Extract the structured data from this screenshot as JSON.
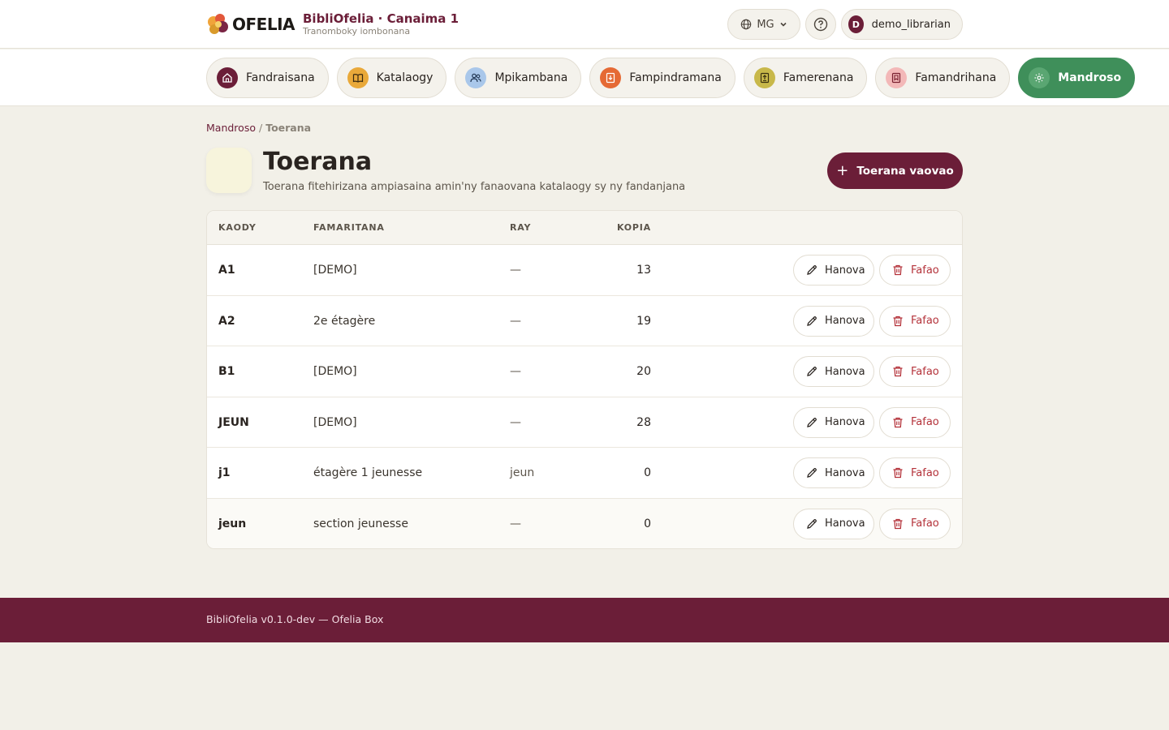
{
  "header": {
    "logo_text": "OFELIA",
    "app_title": "BibliOfelia · Canaima 1",
    "app_subtitle": "Tranomboky iombonana",
    "language": "MG",
    "user_initial": "D",
    "username": "demo_librarian"
  },
  "nav": {
    "items": [
      {
        "label": "Fandraisana",
        "icon": "home-icon",
        "color": "#6b1e38"
      },
      {
        "label": "Katalaogy",
        "icon": "book-icon",
        "color": "#e9a93a"
      },
      {
        "label": "Mpikambana",
        "icon": "users-icon",
        "color": "#a9c7ea"
      },
      {
        "label": "Fampindramana",
        "icon": "loan-icon",
        "color": "#e56a35"
      },
      {
        "label": "Famerenana",
        "icon": "return-icon",
        "color": "#c8b84a"
      },
      {
        "label": "Famandrihana",
        "icon": "reserve-icon",
        "color": "#f3b8b8"
      },
      {
        "label": "Mandroso",
        "icon": "gear-icon",
        "color": "#3f8f5a"
      }
    ],
    "active_index": 6
  },
  "breadcrumb": {
    "parent": "Mandroso",
    "separator": "/",
    "current": "Toerana"
  },
  "page": {
    "title": "Toerana",
    "subtitle": "Toerana fitehirizana ampiasaina amin'ny fanaovana katalaogy sy ny fandanjana",
    "new_button": "Toerana vaovao"
  },
  "table": {
    "columns": [
      "KAODY",
      "FAMARITANA",
      "RAY",
      "KOPIA"
    ],
    "edit_label": "Hanova",
    "delete_label": "Fafao",
    "rows": [
      {
        "code": "A1",
        "description": "[DEMO]",
        "parent": "—",
        "copies": "13"
      },
      {
        "code": "A2",
        "description": "2e étagère",
        "parent": "—",
        "copies": "19"
      },
      {
        "code": "B1",
        "description": "[DEMO]",
        "parent": "—",
        "copies": "20"
      },
      {
        "code": "JEUN",
        "description": "[DEMO]",
        "parent": "—",
        "copies": "28"
      },
      {
        "code": "j1",
        "description": "étagère 1 jeunesse",
        "parent": "jeun",
        "copies": "0"
      },
      {
        "code": "jeun",
        "description": "section jeunesse",
        "parent": "—",
        "copies": "0"
      }
    ]
  },
  "footer": {
    "text": "BibliOfelia v0.1.0-dev — Ofelia Box"
  },
  "colors": {
    "brand": "#6b1e38",
    "active_nav": "#3f8f5a",
    "danger": "#b4323a",
    "background": "#f2f0e8"
  }
}
